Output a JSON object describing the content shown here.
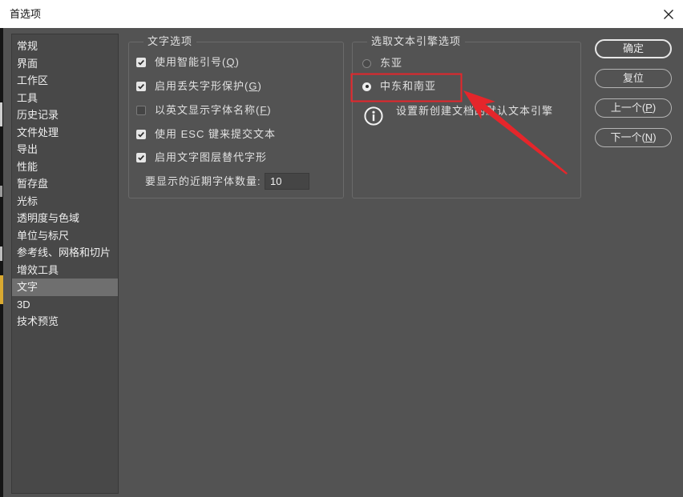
{
  "window": {
    "title": "首选项"
  },
  "icons": {
    "close": "close-icon",
    "info": "info-icon",
    "check": "checkmark-icon"
  },
  "sidebar": {
    "items": [
      "常规",
      "界面",
      "工作区",
      "工具",
      "历史记录",
      "文件处理",
      "导出",
      "性能",
      "暂存盘",
      "光标",
      "透明度与色域",
      "单位与标尺",
      "参考线、网格和切片",
      "增效工具",
      "文字",
      "3D",
      "技术预览"
    ],
    "selected_index": 14
  },
  "text_options": {
    "title": "文字选项",
    "checkboxes": [
      {
        "label": "使用智能引号(Q)",
        "checked": true
      },
      {
        "label": "启用丢失字形保护(G)",
        "checked": true
      },
      {
        "label": "以英文显示字体名称(F)",
        "checked": false
      },
      {
        "label": "使用 ESC 键来提交文本",
        "checked": true
      },
      {
        "label": "启用文字图层替代字形",
        "checked": true
      }
    ],
    "recent_fonts": {
      "label": "要显示的近期字体数量:",
      "value": "10"
    }
  },
  "engine_options": {
    "title": "选取文本引擎选项",
    "radios": [
      {
        "label": "东亚",
        "selected": false
      },
      {
        "label": "中东和南亚",
        "selected": true
      }
    ],
    "info": "设置新创建文档的默认文本引擎"
  },
  "buttons": {
    "ok": "确定",
    "reset": "复位",
    "previous": "上一个(P)",
    "next": "下一个(N)"
  },
  "colors": {
    "dialog_bg": "#535353",
    "panel_bg": "#484848",
    "panel_border": "#393939",
    "selected_row": "#6f6f6f",
    "group_border": "#6a6a6a",
    "text": "#e1e1e1",
    "titlebar_bg": "#ffffff",
    "annotation_red": "#e5262b"
  }
}
